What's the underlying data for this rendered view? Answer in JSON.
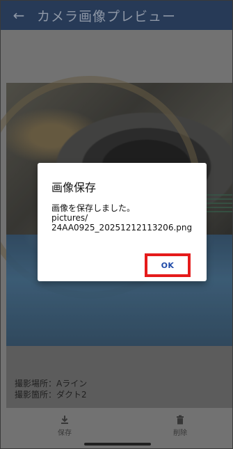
{
  "appbar": {
    "back_icon": "arrow-left-icon",
    "title": "カメラ画像プレビュー"
  },
  "info": {
    "location_line": "撮影場所：Aライン",
    "spot_line": "撮影箇所：ダクト2"
  },
  "bottom_bar": {
    "save_icon": "download-icon",
    "save_label": "保存",
    "delete_icon": "trash-icon",
    "delete_label": "削除"
  },
  "dialog": {
    "title": "画像保存",
    "message": "画像を保存しました。",
    "path_line1": "pictures/",
    "path_line2": "24AA0925_20251212113206.png",
    "ok_label": "OK",
    "highlight_color": "#e51b1b"
  },
  "colors": {
    "appbar": "#273a57",
    "accent": "#1f4aa8"
  }
}
